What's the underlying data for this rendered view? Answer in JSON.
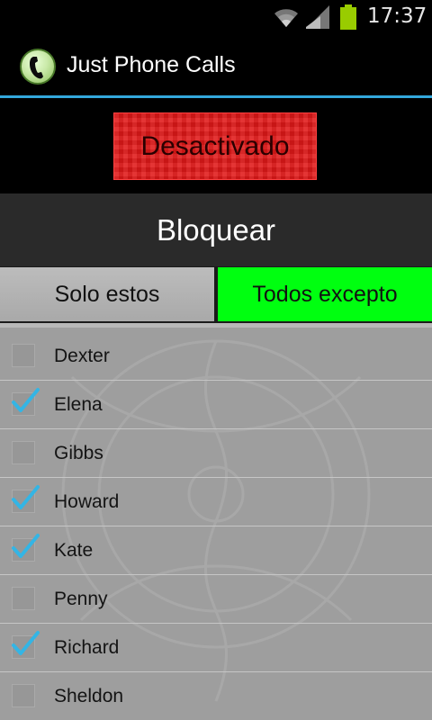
{
  "status_bar": {
    "time": "17:37",
    "icons": [
      "wifi-icon",
      "signal-icon",
      "battery-icon"
    ],
    "battery_color": "#99cc00"
  },
  "action_bar": {
    "title": "Just Phone Calls",
    "icon": "phone-app-icon",
    "accent_color": "#33a8dc"
  },
  "toggle": {
    "label": "Desactivado",
    "color": "#e01818"
  },
  "block_header": {
    "title": "Bloquear"
  },
  "mode_tabs": {
    "left_label": "Solo estos",
    "right_label": "Todos excepto",
    "selected": "Todos excepto",
    "selected_color": "#00ff10"
  },
  "contacts": [
    {
      "name": "Dexter",
      "checked": false
    },
    {
      "name": "Elena",
      "checked": true
    },
    {
      "name": "Gibbs",
      "checked": false
    },
    {
      "name": "Howard",
      "checked": true
    },
    {
      "name": "Kate",
      "checked": true
    },
    {
      "name": "Penny",
      "checked": false
    },
    {
      "name": "Richard",
      "checked": true
    },
    {
      "name": "Sheldon",
      "checked": false
    }
  ],
  "check_color": "#33b5e5"
}
